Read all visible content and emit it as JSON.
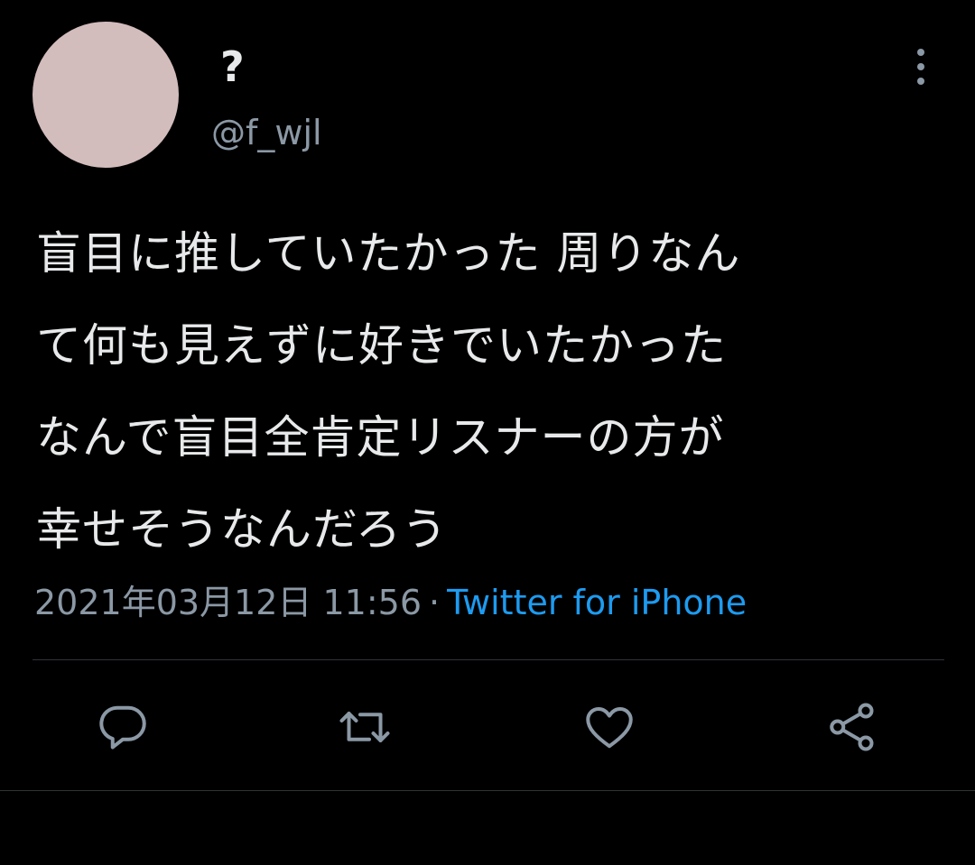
{
  "user": {
    "display_name": "?",
    "handle": "@f_wjl",
    "avatar_color": "#d3bcbc"
  },
  "tweet": {
    "lines": [
      "盲目に推していたかった 周りなん",
      "て何も見えずに好きでいたかった",
      "なんで盲目全肯定リスナーの方が",
      "幸せそうなんだろう"
    ]
  },
  "meta": {
    "timestamp": "2021年03月12日 11:56",
    "separator": "·",
    "source": "Twitter for iPhone"
  },
  "actions": [
    "reply-icon",
    "retweet-icon",
    "like-icon",
    "share-icon"
  ],
  "colors": {
    "background": "#000000",
    "text": "#e7e9ea",
    "secondary": "#8b98a5",
    "link": "#1d9bf0",
    "divider": "#2f3336"
  }
}
